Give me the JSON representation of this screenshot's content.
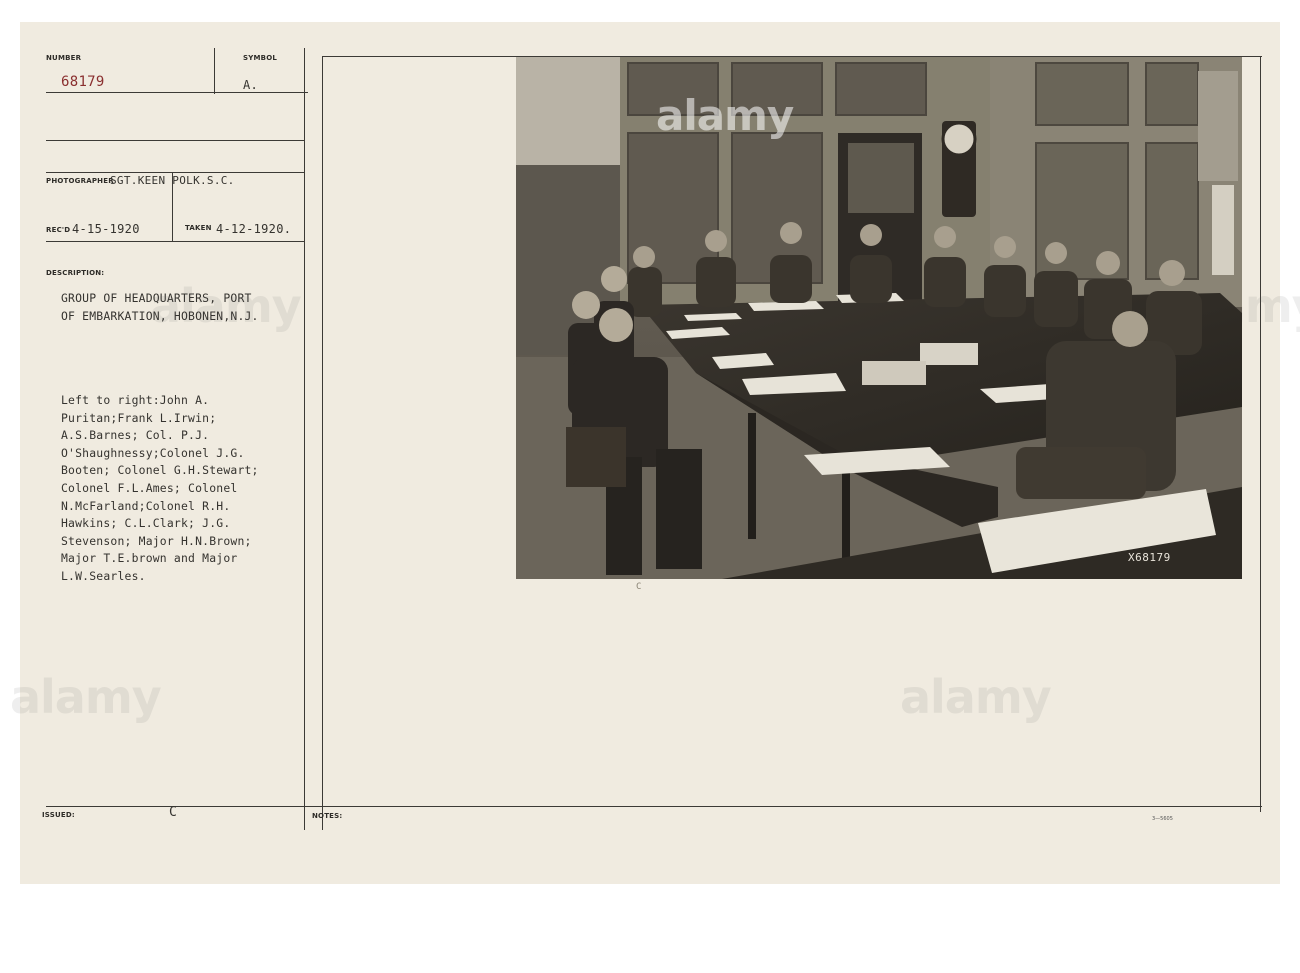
{
  "card": {
    "labels": {
      "number": "NUMBER",
      "symbol": "SYMBOL",
      "photographer": "PHOTOGRAPHER",
      "recd": "REC'D",
      "taken": "TAKEN",
      "description": "DESCRIPTION:",
      "issued": "ISSUED:",
      "notes": "NOTES:"
    },
    "number": "68179",
    "symbol": "A.",
    "photographer": "SGT.KEEN POLK.S.C.",
    "recd": "4-15-1920",
    "taken": "4-12-1920.",
    "description_title": "GROUP OF HEADQUARTERS, PORT\nOF EMBARKATION, HOBONEN,N.J.",
    "description_body": "Left to right:John A.\nPuritan;Frank L.Irwin;\nA.S.Barnes; Col. P.J.\nO'Shaughnessy;Colonel J.G.\nBooten; Colonel G.H.Stewart;\nColonel F.L.Ames; Colonel\nN.McFarland;Colonel R.H.\nHawkins; C.L.Clark; J.G.\nStevenson; Major H.N.Brown;\nMajor T.E.brown and Major\nL.W.Searles.",
    "issued_mark": "C",
    "form_code": "3—5605"
  },
  "photo": {
    "negative_number": "X68179",
    "stamp": "C"
  },
  "watermark": "alamy"
}
